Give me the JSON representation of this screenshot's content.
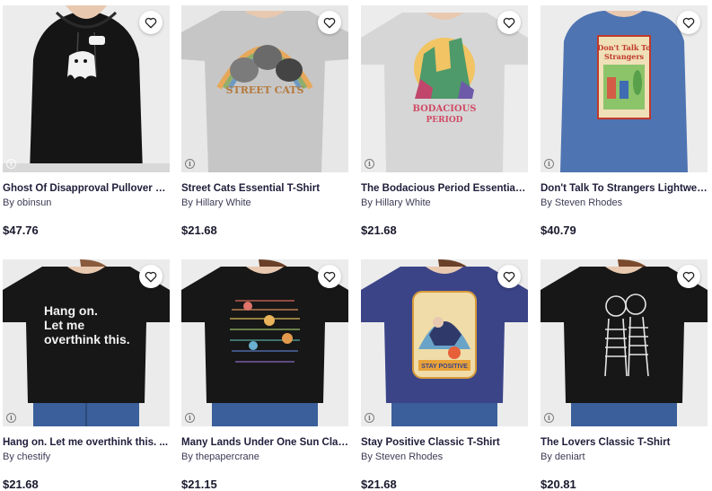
{
  "products": [
    {
      "title": "Ghost Of Disapproval Pullover H...",
      "artist": "By obinsun",
      "price": "$47.76",
      "bg": "#e9e9e9",
      "shirt": "#161616",
      "kind": "hoodie",
      "print": "boo"
    },
    {
      "title": "Street Cats Essential T-Shirt",
      "artist": "By Hillary White",
      "price": "$21.68",
      "bg": "#e7e7e7",
      "shirt": "#c9c9c9",
      "kind": "tee",
      "print": "STREET CATS"
    },
    {
      "title": "The Bodacious Period Essential ...",
      "artist": "By Hillary White",
      "price": "$21.68",
      "bg": "#e9e9e9",
      "shirt": "#d6d6d6",
      "kind": "tee",
      "print": "BODACIOUS PERIOD"
    },
    {
      "title": "Don't Talk To Strangers Lightwei...",
      "artist": "By Steven Rhodes",
      "price": "$40.79",
      "bg": "#e9e9e9",
      "shirt": "#4f74b2",
      "kind": "sweatshirt",
      "print": "Don't Talk To Strangers"
    },
    {
      "title": "Hang on. Let me overthink this. ...",
      "artist": "By chestify",
      "price": "$21.68",
      "bg": "#e8e8e8",
      "shirt": "#161616",
      "kind": "tee",
      "print": "Hang on. Let me overthink this."
    },
    {
      "title": "Many Lands Under One Sun Clas...",
      "artist": "By thepapercrane",
      "price": "$21.15",
      "bg": "#e9e9e9",
      "shirt": "#171717",
      "kind": "tee",
      "print": ""
    },
    {
      "title": "Stay Positive Classic T-Shirt",
      "artist": "By Steven Rhodes",
      "price": "$21.68",
      "bg": "#e9e9e9",
      "shirt": "#3b4487",
      "kind": "tee",
      "print": "STAY POSITIVE"
    },
    {
      "title": "The Lovers Classic T-Shirt",
      "artist": "By deniart",
      "price": "$20.81",
      "bg": "#e9e9e9",
      "shirt": "#171717",
      "kind": "tee",
      "print": ""
    }
  ],
  "icons": {
    "favorite": "heart-outline-icon",
    "info": "info-icon"
  }
}
